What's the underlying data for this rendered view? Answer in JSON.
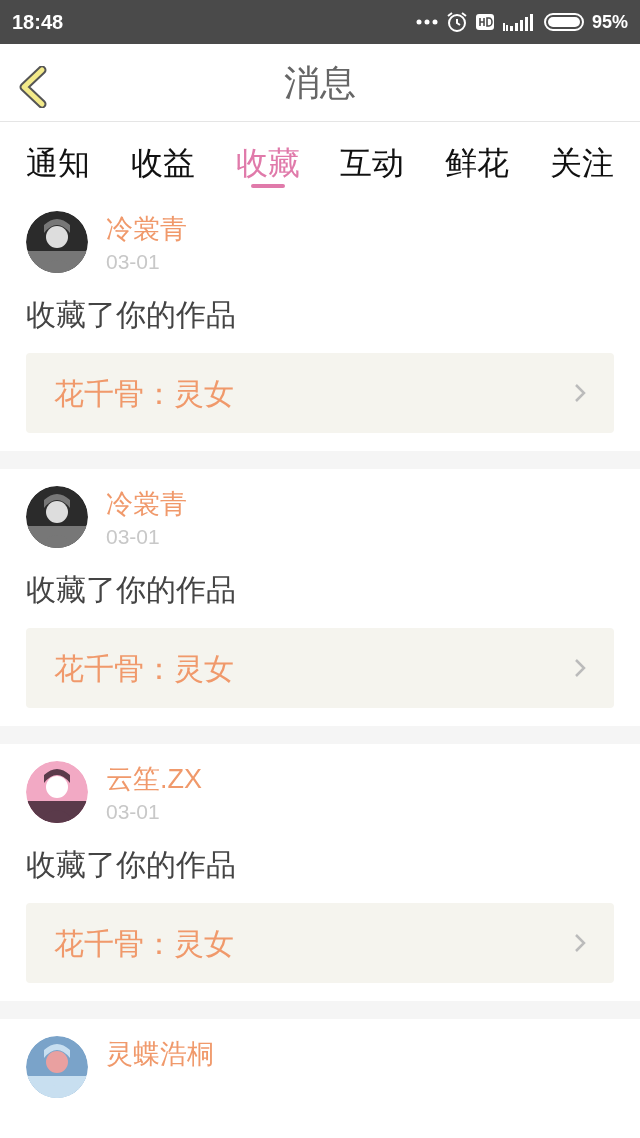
{
  "status_bar": {
    "time": "18:48",
    "battery": "95%"
  },
  "header": {
    "title": "消息"
  },
  "tabs": [
    {
      "label": "通知",
      "selected": false
    },
    {
      "label": "收益",
      "selected": false
    },
    {
      "label": "收藏",
      "selected": true
    },
    {
      "label": "互动",
      "selected": false
    },
    {
      "label": "鲜花",
      "selected": false
    },
    {
      "label": "关注",
      "selected": false
    }
  ],
  "messages": [
    {
      "user": "冷裳青",
      "date": "03-01",
      "text": "收藏了你的作品",
      "work": "花千骨：灵女"
    },
    {
      "user": "冷裳青",
      "date": "03-01",
      "text": "收藏了你的作品",
      "work": "花千骨：灵女"
    },
    {
      "user": "云笙.ZX",
      "date": "03-01",
      "text": "收藏了你的作品",
      "work": "花千骨：灵女"
    },
    {
      "user": "灵蝶浩桐"
    }
  ]
}
